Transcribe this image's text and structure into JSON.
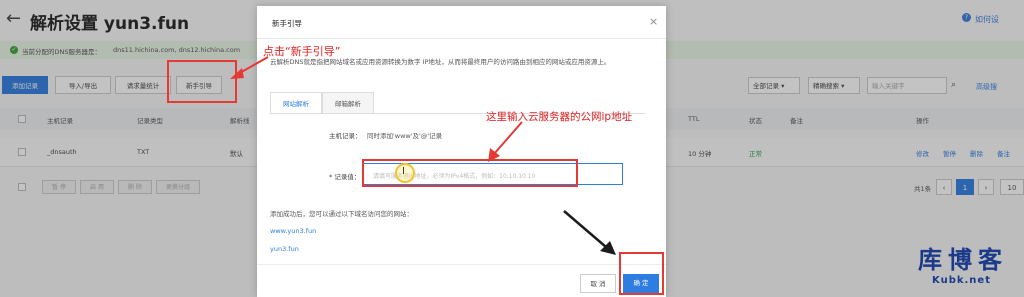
{
  "header": {
    "title": "解析设置 yun3.fun",
    "help": "如何设"
  },
  "dns_bar": {
    "label": "当前分配的DNS服务器是：",
    "servers": "dns11.hichina.com, dns12.hichina.com"
  },
  "toolbar": {
    "add_record": "添加记录",
    "import_export": "导入/导出",
    "request_stats": "请求量统计",
    "newbie_guide": "新手引导"
  },
  "filters": {
    "all_records": "全部记录",
    "exact_search": "精确搜索",
    "search_placeholder": "输入关键字",
    "advanced_search": "高级搜"
  },
  "table": {
    "headers": [
      "主机记录",
      "记录类型",
      "解析线",
      "TTL",
      "状态",
      "备注",
      "操作"
    ],
    "rows": [
      {
        "host": "_dnsauth",
        "type": "TXT",
        "line": "默认",
        "ttl": "10 分钟",
        "status": "正常",
        "actions": [
          "修改",
          "暂停",
          "删除",
          "备注"
        ]
      }
    ]
  },
  "batch": {
    "buttons": [
      "暂 停",
      "启 用",
      "删 除",
      "更换分组"
    ]
  },
  "pagination": {
    "total": "共1条",
    "prev": "‹",
    "current": "1",
    "next": "›",
    "page_size": "10"
  },
  "modal": {
    "title": "新手引导",
    "close": "×",
    "description": "云解析DNS就是指把网站域名或应用资源转换为数字 IP地址，从而将最终用户的访问路由到相应的网站或应用资源上。",
    "tabs": [
      "网站解析",
      "邮箱解析"
    ],
    "host_label": "主机记录：",
    "host_value": "同时添加'www'及'@'记录",
    "record_label": "* 记录值：",
    "record_placeholder": "请填写服务器IP地址，必须为IPv4格式，例如：10.10.10.10",
    "after_text": "添加成功后，您可以通过以下域名访问您的网站：",
    "domains": [
      "www.yun3.fun",
      "yun3.fun"
    ],
    "cancel": "取 消",
    "confirm": "确 定"
  },
  "annotations": {
    "click_guide": "点击“新手引导”",
    "enter_ip": "这里输入云服务器的公网ip地址"
  },
  "watermark": {
    "brand": "库博客",
    "url": "Kubk.net"
  },
  "colors": {
    "primary": "#2e7de1",
    "annotation_red": "#e53935",
    "success_green": "#2aa148"
  }
}
